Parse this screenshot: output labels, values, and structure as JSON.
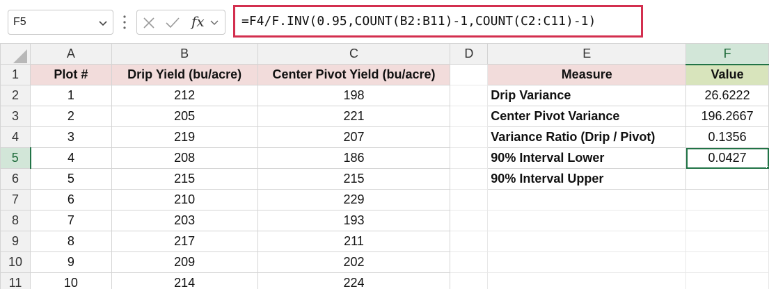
{
  "name_box": {
    "value": "F5"
  },
  "formula_bar": {
    "formula": "=F4/F.INV(0.95,COUNT(B2:B11)-1,COUNT(C2:C11)-1)",
    "fx_label": "fx"
  },
  "columns": [
    "A",
    "B",
    "C",
    "D",
    "E",
    "F"
  ],
  "selected_column": "F",
  "selected_row": "5",
  "rows": [
    "1",
    "2",
    "3",
    "4",
    "5",
    "6",
    "7",
    "8",
    "9",
    "10",
    "11"
  ],
  "left_table": {
    "headers": [
      "Plot #",
      "Drip Yield (bu/acre)",
      "Center Pivot Yield (bu/acre)"
    ],
    "data": [
      [
        "1",
        "212",
        "198"
      ],
      [
        "2",
        "205",
        "221"
      ],
      [
        "3",
        "219",
        "207"
      ],
      [
        "4",
        "208",
        "186"
      ],
      [
        "5",
        "215",
        "215"
      ],
      [
        "6",
        "210",
        "229"
      ],
      [
        "7",
        "203",
        "193"
      ],
      [
        "8",
        "217",
        "211"
      ],
      [
        "9",
        "209",
        "202"
      ],
      [
        "10",
        "214",
        "224"
      ]
    ]
  },
  "right_table": {
    "headers": [
      "Measure",
      "Value"
    ],
    "data": [
      [
        "Drip Variance",
        "26.6222"
      ],
      [
        "Center Pivot Variance",
        "196.2667"
      ],
      [
        "Variance Ratio (Drip / Pivot)",
        "0.1356"
      ],
      [
        "90% Interval Lower",
        "0.0427"
      ],
      [
        "90% Interval Upper",
        ""
      ]
    ]
  },
  "colors": {
    "header_pink": "#f2dcdb",
    "header_green": "#d8e4bc",
    "selection_green": "#217346",
    "formula_highlight": "#d32f4f"
  }
}
